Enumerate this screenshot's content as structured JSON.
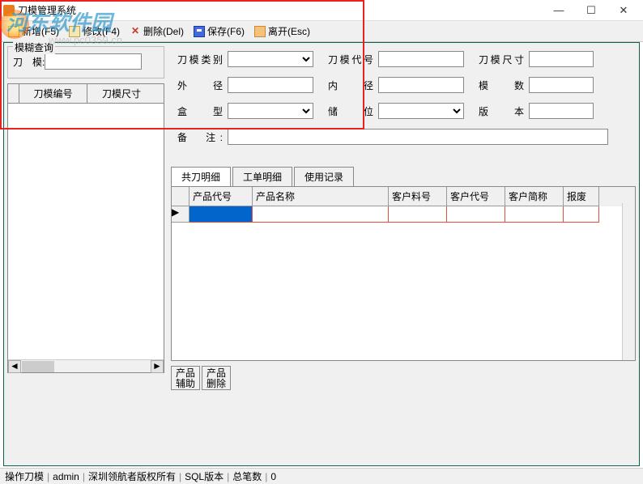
{
  "watermark": "河东软件园",
  "watermark_url": "www.pc0359.cn",
  "title": "刀模管理系统",
  "toolbar": {
    "new": "新增(F5)",
    "edit": "修改(F4)",
    "delete": "删除(Del)",
    "save": "保存(F6)",
    "exit": "离开(Esc)"
  },
  "query": {
    "legend": "模糊查询",
    "label": "刀　模:",
    "col1": "刀模编号",
    "col2": "刀模尺寸"
  },
  "form": {
    "type": "刀模类别",
    "code": "刀模代号",
    "size": "刀模尺寸",
    "outer": "外　径",
    "inner": "内　径",
    "count": "模　数",
    "box": "盒　型",
    "slot": "储　位",
    "version": "版　本",
    "remark": "备　注:"
  },
  "tabs": {
    "t1": "共刀明细",
    "t2": "工单明细",
    "t3": "使用记录"
  },
  "grid": {
    "c1": "产品代号",
    "c2": "产品名称",
    "c3": "客户料号",
    "c4": "客户代号",
    "c5": "客户简称",
    "c6": "报废"
  },
  "btns": {
    "assist": "产品辅助",
    "del": "产品删除"
  },
  "status": {
    "s1": "操作刀模",
    "s2": "admin",
    "s3": "深圳领航者版权所有",
    "s4": "SQL版本",
    "s5": "总笔数",
    "s6": "0"
  }
}
